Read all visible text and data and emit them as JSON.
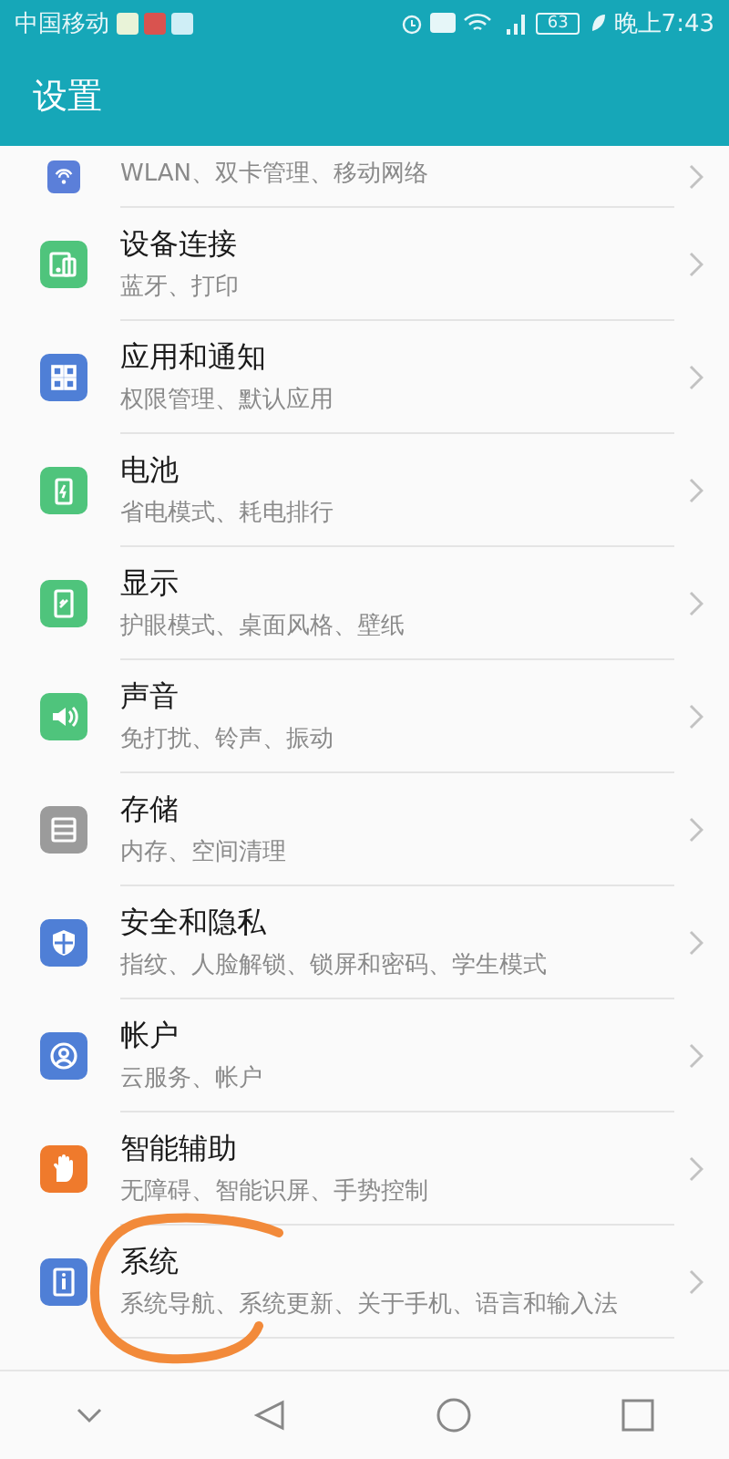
{
  "status_bar": {
    "carrier": "中国移动",
    "battery": "63",
    "time": "晚上7:43"
  },
  "header": {
    "title": "设置"
  },
  "items": [
    {
      "kind": "partial",
      "subtitle": "WLAN、双卡管理、移动网络",
      "color": "#5b7fd9"
    },
    {
      "kind": "full",
      "title": "设备连接",
      "subtitle": "蓝牙、打印",
      "color": "#4fc47c"
    },
    {
      "kind": "full",
      "title": "应用和通知",
      "subtitle": "权限管理、默认应用",
      "color": "#4f7fd6"
    },
    {
      "kind": "full",
      "title": "电池",
      "subtitle": "省电模式、耗电排行",
      "color": "#4fc47c"
    },
    {
      "kind": "full",
      "title": "显示",
      "subtitle": "护眼模式、桌面风格、壁纸",
      "color": "#4fc47c"
    },
    {
      "kind": "full",
      "title": "声音",
      "subtitle": "免打扰、铃声、振动",
      "color": "#4fc47c"
    },
    {
      "kind": "full",
      "title": "存储",
      "subtitle": "内存、空间清理",
      "color": "#9b9b9b"
    },
    {
      "kind": "full",
      "title": "安全和隐私",
      "subtitle": "指纹、人脸解锁、锁屏和密码、学生模式",
      "color": "#4f7fd6"
    },
    {
      "kind": "full",
      "title": "帐户",
      "subtitle": "云服务、帐户",
      "color": "#4f7fd6"
    },
    {
      "kind": "full",
      "title": "智能辅助",
      "subtitle": "无障碍、智能识屏、手势控制",
      "color": "#ef7a2c"
    },
    {
      "kind": "full",
      "title": "系统",
      "subtitle": "系统导航、系统更新、关于手机、语言和输入法",
      "color": "#4f7fd6"
    }
  ],
  "annotation": {
    "color": "#f28a3a"
  }
}
